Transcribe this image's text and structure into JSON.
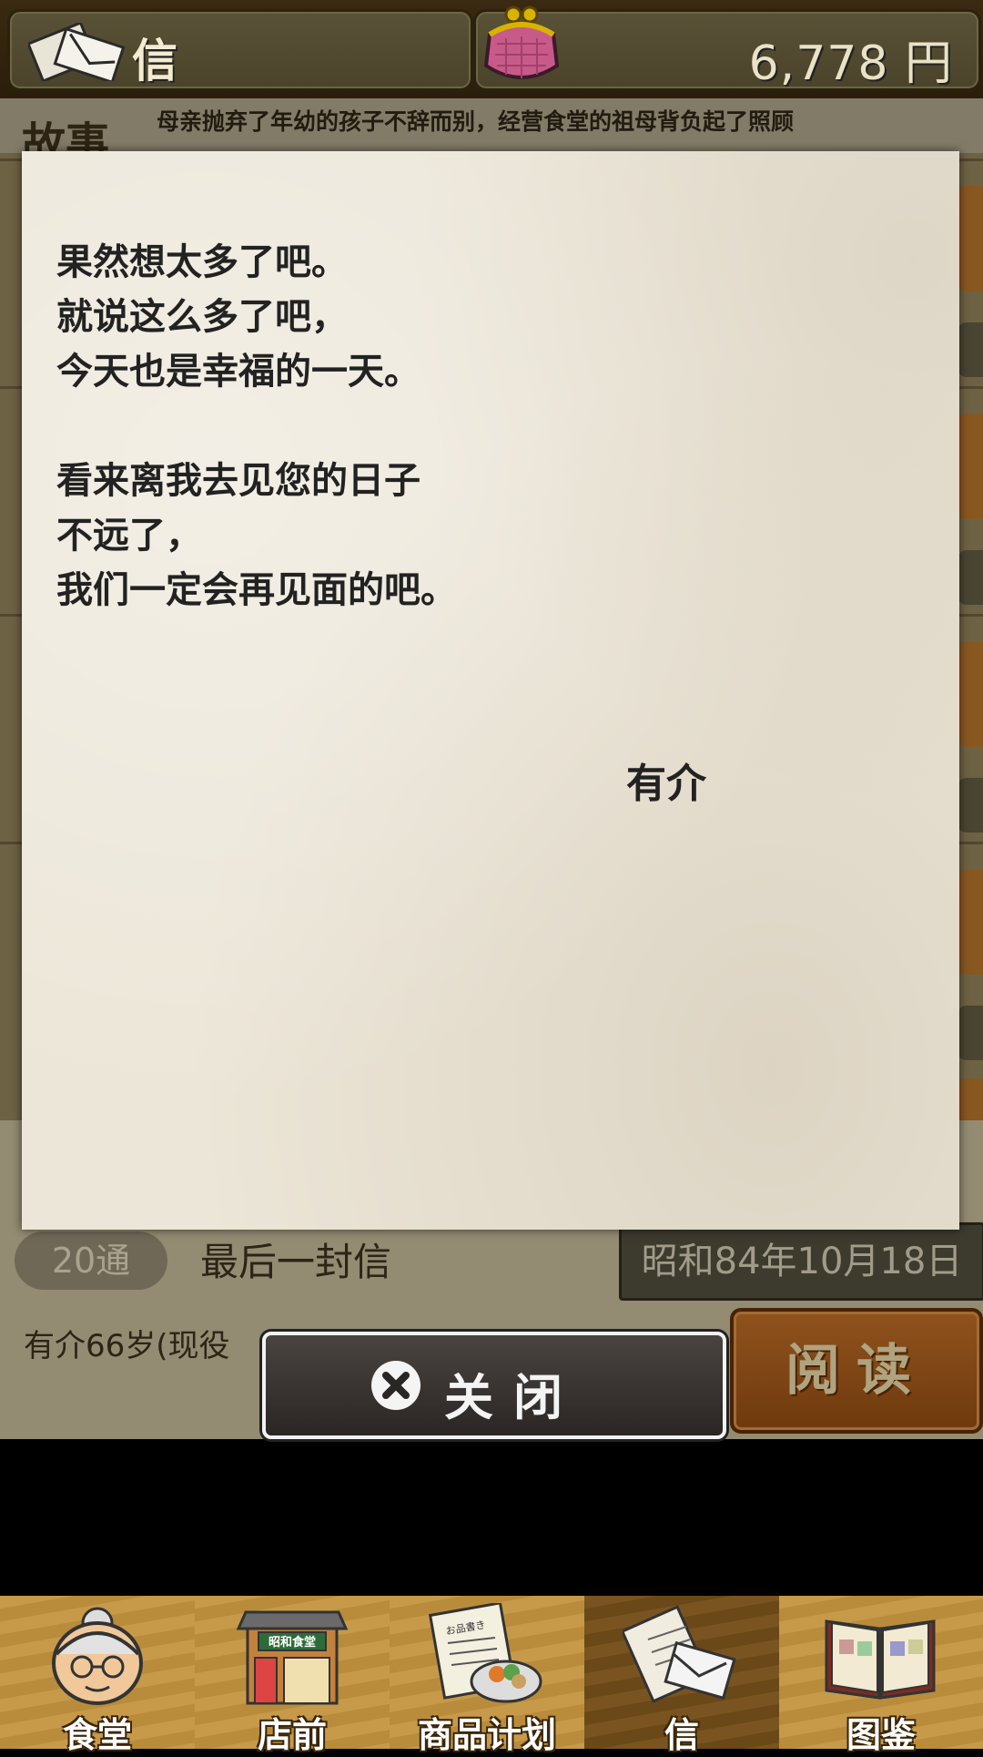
{
  "header": {
    "title": "信",
    "money": "6,778 円"
  },
  "story": {
    "label": "故事",
    "text": "母亲抛弃了年幼的孩子不辞而别，经营食堂的祖母背负起了照顾"
  },
  "letter": {
    "lines": [
      "果然想太多了吧。",
      "就说这么多了吧，",
      "今天也是幸福的一天。",
      "",
      "看来离我去见您的日子",
      "不远了，",
      "我们一定会再见面的吧。"
    ],
    "signature": "有介"
  },
  "letter_item": {
    "count": "20通",
    "name": "最后一封信",
    "date": "昭和84年10月18日",
    "age_text": "有介66岁(现役",
    "read_label": "阅读"
  },
  "close_label": "关闭",
  "nav": {
    "items": [
      {
        "label": "食堂",
        "icon": "grandma-icon"
      },
      {
        "label": "店前",
        "icon": "shop-front-icon"
      },
      {
        "label": "商品计划",
        "icon": "menu-plan-icon"
      },
      {
        "label": "信",
        "icon": "letters-icon"
      },
      {
        "label": "图鉴",
        "icon": "book-icon"
      }
    ],
    "shop_sign": "昭和食堂",
    "menu_card_text": "お品書き"
  },
  "colors": {
    "paper": "#ece6d8",
    "nav_wood": "#c79a4a",
    "read_button": "#b86a26",
    "header_panel": "#5a5237"
  }
}
